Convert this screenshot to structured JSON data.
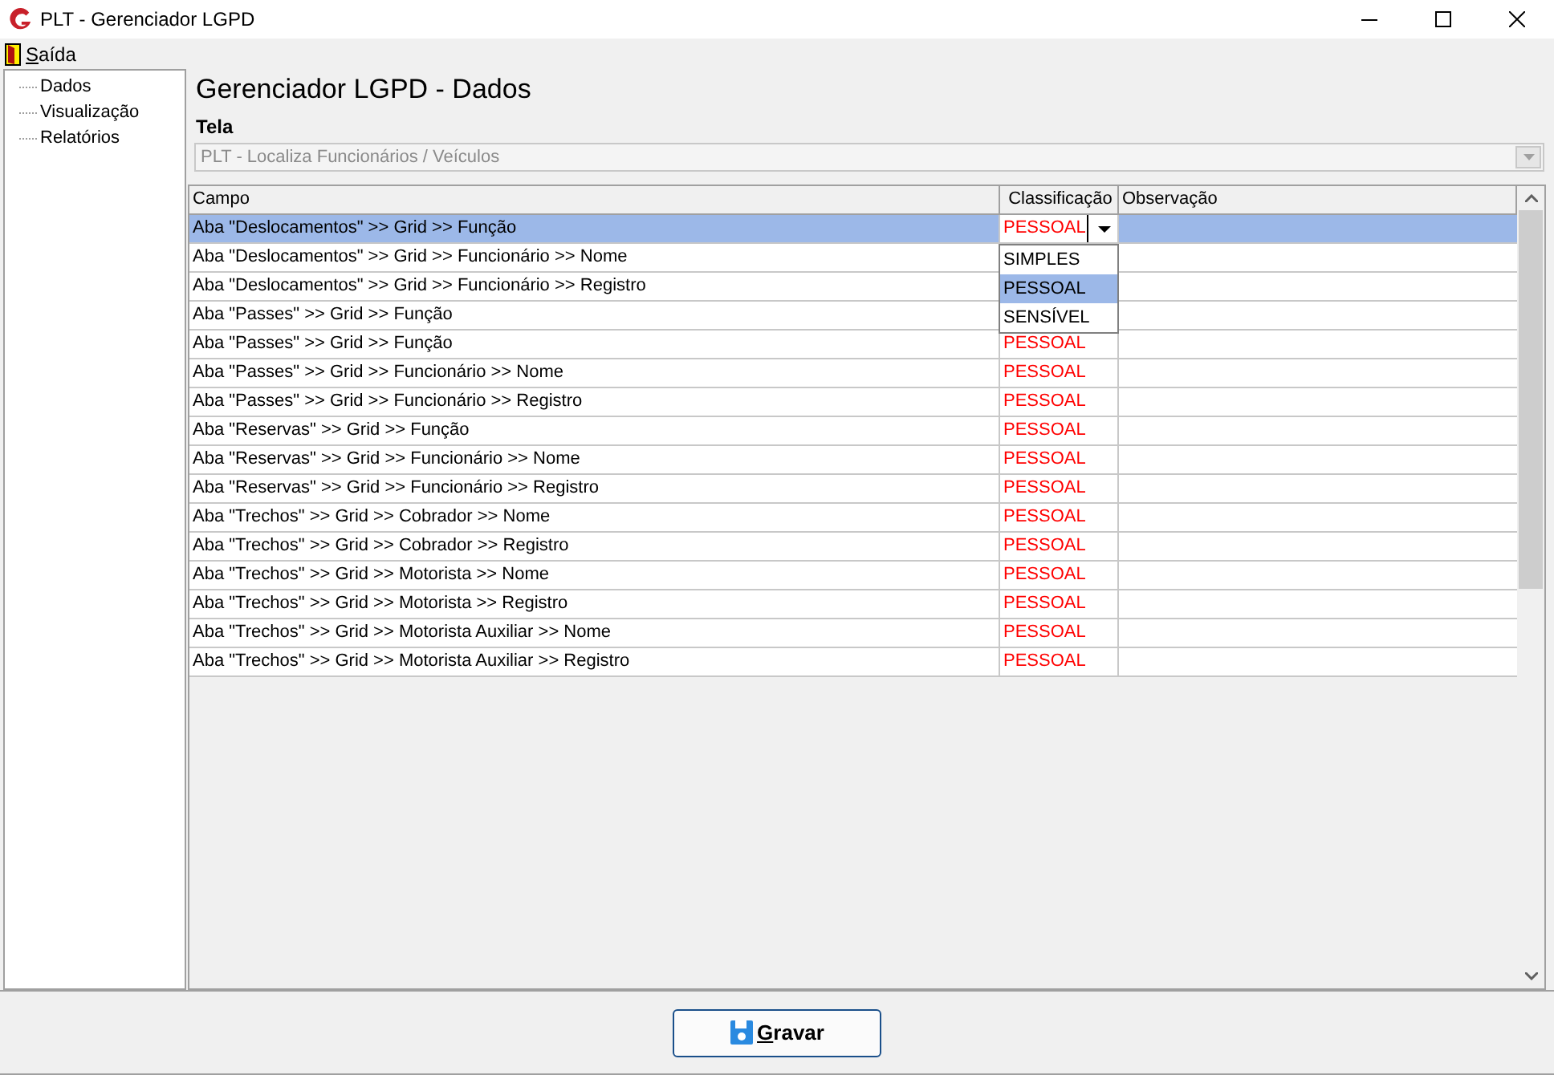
{
  "window": {
    "title": "PLT - Gerenciador LGPD"
  },
  "menu": [
    {
      "label": "Saída",
      "mnemonic": true
    }
  ],
  "sidebar": {
    "items": [
      {
        "label": "Dados"
      },
      {
        "label": "Visualização"
      },
      {
        "label": "Relatórios"
      }
    ]
  },
  "heading": "Gerenciador LGPD - Dados",
  "tela": {
    "label": "Tela",
    "value": "PLT - Localiza Funcionários / Veículos",
    "disabled": true
  },
  "table": {
    "columns": [
      "Campo",
      "Classificação",
      "Observação"
    ],
    "rows": [
      {
        "campo": "Aba \"Deslocamentos\" >> Grid >> Função",
        "classificacao": "PESSOAL",
        "selected": true,
        "editing": true
      },
      {
        "campo": "Aba \"Deslocamentos\" >> Grid >> Funcionário >> Nome",
        "selected": false
      },
      {
        "campo": "Aba \"Deslocamentos\" >> Grid >> Funcionário >> Registro",
        "selected": false
      },
      {
        "campo": "Aba \"Passes\" >> Grid >> Função",
        "selected": false
      },
      {
        "campo": "Aba \"Passes\" >> Grid >> Função",
        "classificacao": "PESSOAL",
        "selected": false
      },
      {
        "campo": "Aba \"Passes\" >> Grid >> Funcionário >> Nome",
        "classificacao": "PESSOAL",
        "selected": false
      },
      {
        "campo": "Aba \"Passes\" >> Grid >> Funcionário >> Registro",
        "classificacao": "PESSOAL",
        "selected": false
      },
      {
        "campo": "Aba \"Reservas\" >> Grid >> Função",
        "classificacao": "PESSOAL",
        "selected": false
      },
      {
        "campo": "Aba \"Reservas\" >> Grid >> Funcionário >> Nome",
        "classificacao": "PESSOAL",
        "selected": false
      },
      {
        "campo": "Aba \"Reservas\" >> Grid >> Funcionário >> Registro",
        "classificacao": "PESSOAL",
        "selected": false
      },
      {
        "campo": "Aba \"Trechos\" >> Grid >> Cobrador >> Nome",
        "classificacao": "PESSOAL",
        "selected": false
      },
      {
        "campo": "Aba \"Trechos\" >> Grid >> Cobrador >> Registro",
        "classificacao": "PESSOAL",
        "selected": false
      },
      {
        "campo": "Aba \"Trechos\" >> Grid >> Motorista >> Nome",
        "classificacao": "PESSOAL",
        "selected": false
      },
      {
        "campo": "Aba \"Trechos\" >> Grid >> Motorista >> Registro",
        "classificacao": "PESSOAL",
        "selected": false
      },
      {
        "campo": "Aba \"Trechos\" >> Grid >> Motorista Auxiliar >> Nome",
        "classificacao": "PESSOAL",
        "selected": false
      },
      {
        "campo": "Aba \"Trechos\" >> Grid >> Motorista Auxiliar >> Registro",
        "classificacao": "PESSOAL",
        "selected": false
      }
    ],
    "dropdown": [
      {
        "label": "SIMPLES",
        "selected": false
      },
      {
        "label": "PESSOAL",
        "selected": true
      },
      {
        "label": "SENSÍVEL",
        "selected": false
      }
    ]
  },
  "save_button": {
    "label": "Gravar",
    "mnemonic": true
  }
}
